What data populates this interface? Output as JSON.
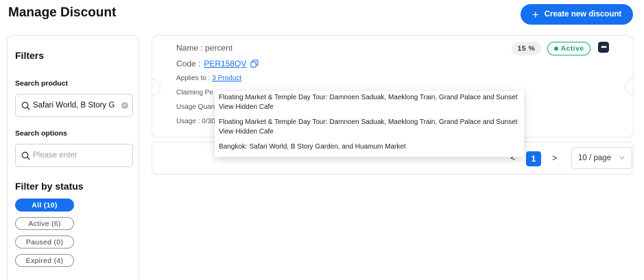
{
  "header": {
    "title": "Manage Discount",
    "create_button_label": "Create new discount",
    "create_button_icon": "plus-icon"
  },
  "filters": {
    "title": "Filters",
    "search_product": {
      "label": "Search product",
      "value": "Safari World, B Story G",
      "icon": "search-icon"
    },
    "search_options": {
      "label": "Search options",
      "placeholder": "Please enter"
    },
    "status_title": "Filter by status",
    "status_options": [
      {
        "label": "All (10)",
        "selected": true
      },
      {
        "label": "Active (6)",
        "selected": false
      },
      {
        "label": "Paused (0)",
        "selected": false
      },
      {
        "label": "Expired (4)",
        "selected": false
      }
    ]
  },
  "discount": {
    "name_line": "Name : percent",
    "code_label": "Code :",
    "code_value": "PER158QV",
    "applies_label": "Applies to :",
    "applies_link": "3 Product",
    "claiming_label": "Claiming Pe",
    "usage_quota_label": "Usage Quan",
    "usage_label": "Usage : 0/30",
    "percent_badge": "15 %",
    "status_badge": "Active",
    "more_label": "•••",
    "accent_color": "#1570ef",
    "status_color": "#179f83"
  },
  "product_dropdown": {
    "items": [
      "Floating Market & Temple Day Tour: Damnoen Saduak, Maeklong Train, Grand Palace and Sunset View Hidden Cafe",
      "Floating Market & Temple Day Tour: Damnoen Saduak, Maeklong Train, Grand Palace and Sunset View Hidden Cafe",
      "Bangkok: Safari World, B Story Garden, and Huamum Market"
    ]
  },
  "pagination": {
    "prev": "<",
    "current_page": "1",
    "next": ">",
    "page_size": "10 / page"
  }
}
